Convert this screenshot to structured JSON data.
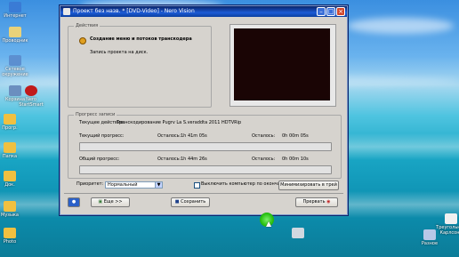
{
  "window": {
    "title": "Проект без назв. * [DVD-Video] - Nero Vision"
  },
  "actions_group": {
    "label": "Действия",
    "item_title": "Создание меню и потоков транскодера",
    "item_subtitle": "Запись проекта на диск."
  },
  "progress_group": {
    "label": "Прогресс записи",
    "current_action_label": "Текущее действие:",
    "current_action_value": "Транскодирование Pugrv La S.veraddta 2011 HDTVRip",
    "current_progress_label": "Текущий прогресс:",
    "current_remaining_label": "Осталось:",
    "current_remaining_value": "1h 41m 05s",
    "current_elapsed_label": "Осталось:",
    "current_elapsed_value": "0h 00m 05s",
    "current_progress_fraction": 0.0,
    "total_progress_label": "Общий прогресс:",
    "total_remaining_label": "Осталось:",
    "total_remaining_value": "1h 44m 26s",
    "total_elapsed_label": "Осталось:",
    "total_elapsed_value": "0h 00m 10s",
    "total_progress_fraction": 0.0
  },
  "options": {
    "priority_label": "Приоритет:",
    "priority_value": "Нормальный",
    "shutdown_label": "Выключить компьютер по окончании",
    "minimize_button": "Минимизировать в трей"
  },
  "footer": {
    "more_button": "Еще >>",
    "save_button": "Сохранить",
    "abort_button": "Прервать"
  },
  "desktop": {
    "icons_left": [
      "Интернет",
      "Проводник",
      "Сетевое окружение",
      "Nero StartSmart",
      "Корзина",
      "Прогр.",
      "Папка",
      "Док.",
      "Музыка",
      "Photo",
      "Копьютер"
    ],
    "icons_bottom_right": [
      "Разное",
      "Треугольник Карлсона"
    ],
    "sidebar_text": "TeamViewer"
  },
  "colors": {
    "title_bar": "#0a246a",
    "window_bg": "#d6d3ce",
    "preview_bg": "#1a0505"
  }
}
